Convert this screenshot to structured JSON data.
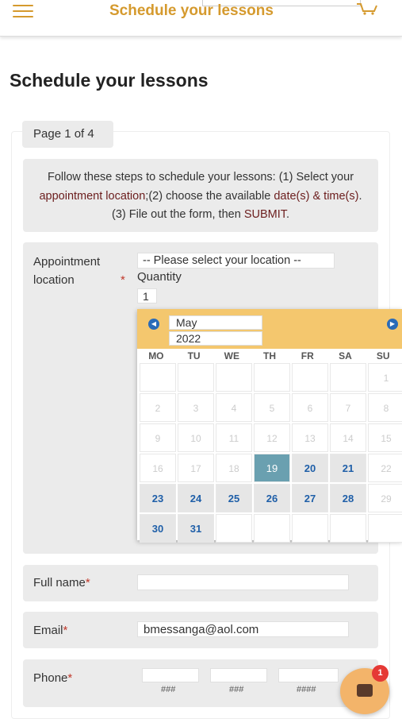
{
  "header": {
    "title": "Schedule your lessons"
  },
  "page_title": "Schedule your lessons",
  "page_indicator": "Page 1 of 4",
  "instructions": {
    "part1": "Follow these steps to schedule your lessons: (1) Select your ",
    "highlight1": "appointment location",
    "part2": ";(2) choose the available ",
    "highlight2": "date(s) & time(s)",
    "part3": ". (3) File out the form, then ",
    "highlight3": "SUBMIT",
    "part4": "."
  },
  "location": {
    "label": "Appointment location",
    "required_mark": "*",
    "select_value": "-- Please select your location --",
    "quantity_label": "Quantity",
    "quantity_value": "1"
  },
  "calendar": {
    "month": "May",
    "year": "2022",
    "days_of_week": [
      "MO",
      "TU",
      "WE",
      "TH",
      "FR",
      "SA",
      "SU"
    ],
    "days": [
      {
        "label": "",
        "state": "empty"
      },
      {
        "label": "",
        "state": "empty"
      },
      {
        "label": "",
        "state": "empty"
      },
      {
        "label": "",
        "state": "empty"
      },
      {
        "label": "",
        "state": "empty"
      },
      {
        "label": "",
        "state": "empty"
      },
      {
        "label": "1",
        "state": "disabled"
      },
      {
        "label": "2",
        "state": "disabled"
      },
      {
        "label": "3",
        "state": "disabled"
      },
      {
        "label": "4",
        "state": "disabled"
      },
      {
        "label": "5",
        "state": "disabled"
      },
      {
        "label": "6",
        "state": "disabled"
      },
      {
        "label": "7",
        "state": "disabled"
      },
      {
        "label": "8",
        "state": "disabled"
      },
      {
        "label": "9",
        "state": "disabled"
      },
      {
        "label": "10",
        "state": "disabled"
      },
      {
        "label": "11",
        "state": "disabled"
      },
      {
        "label": "12",
        "state": "disabled"
      },
      {
        "label": "13",
        "state": "disabled"
      },
      {
        "label": "14",
        "state": "disabled"
      },
      {
        "label": "15",
        "state": "disabled"
      },
      {
        "label": "16",
        "state": "disabled"
      },
      {
        "label": "17",
        "state": "disabled"
      },
      {
        "label": "18",
        "state": "disabled"
      },
      {
        "label": "19",
        "state": "selected"
      },
      {
        "label": "20",
        "state": "active"
      },
      {
        "label": "21",
        "state": "active"
      },
      {
        "label": "22",
        "state": "disabled"
      },
      {
        "label": "23",
        "state": "active"
      },
      {
        "label": "24",
        "state": "active"
      },
      {
        "label": "25",
        "state": "active"
      },
      {
        "label": "26",
        "state": "active"
      },
      {
        "label": "27",
        "state": "active"
      },
      {
        "label": "28",
        "state": "active"
      },
      {
        "label": "29",
        "state": "disabled"
      },
      {
        "label": "30",
        "state": "active"
      },
      {
        "label": "31",
        "state": "active"
      },
      {
        "label": "",
        "state": "empty"
      },
      {
        "label": "",
        "state": "empty"
      },
      {
        "label": "",
        "state": "empty"
      },
      {
        "label": "",
        "state": "empty"
      },
      {
        "label": "",
        "state": "empty"
      }
    ]
  },
  "form": {
    "full_name_label": "Full name",
    "full_name_value": "",
    "email_label": "Email",
    "email_value": "bmessanga@aol.com",
    "phone_label": "Phone",
    "phone_hint_1": "###",
    "phone_hint_2": "###",
    "phone_hint_3": "####",
    "required_mark": "*"
  },
  "chat": {
    "badge_count": "1"
  },
  "colors": {
    "accent": "#d59a2e",
    "calendar_header": "#f4c76e",
    "selected_day": "#6aa0b0",
    "active_day_text": "#1f5fa8",
    "required": "#c0392b",
    "chat_button": "#f3b46a"
  }
}
